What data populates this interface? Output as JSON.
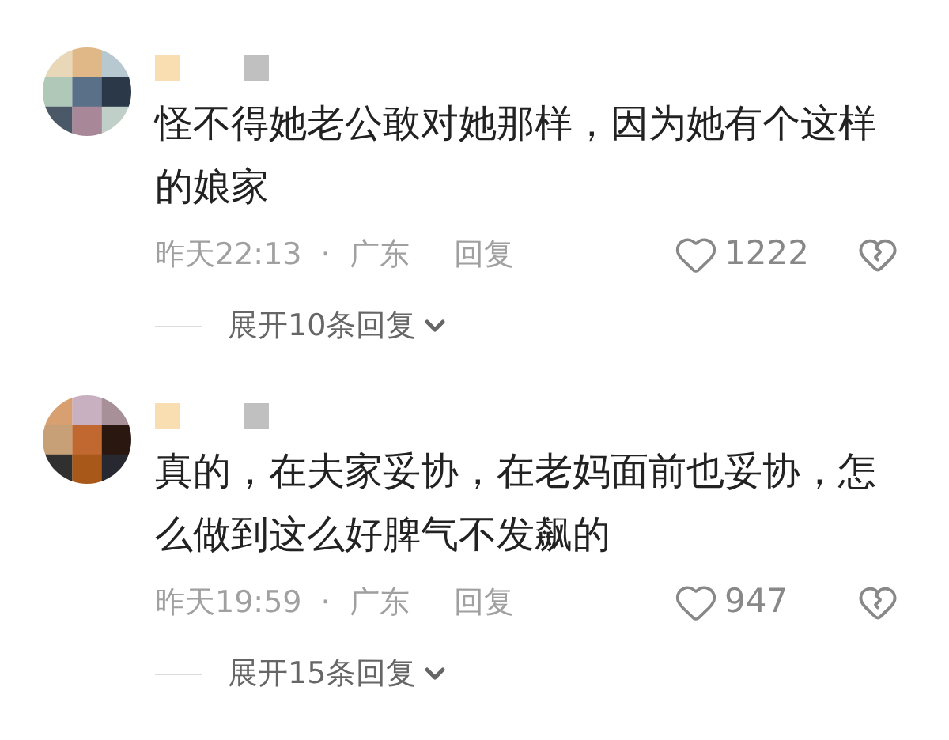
{
  "comments": [
    {
      "text": "怪不得她老公敢对她那样，因为她有个这样的娘家",
      "time": "昨天22:13",
      "separator": "·",
      "location": "广东",
      "reply": "回复",
      "likes": "1222",
      "expand": "展开10条回复"
    },
    {
      "text": "真的，在夫家妥协，在老妈面前也妥协，怎么做到这么好脾气不发飙的",
      "time": "昨天19:59",
      "separator": "·",
      "location": "广东",
      "reply": "回复",
      "likes": "947",
      "expand": "展开15条回复"
    }
  ]
}
